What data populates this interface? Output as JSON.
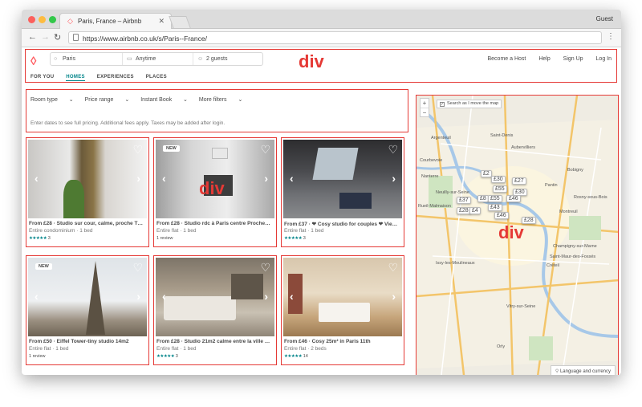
{
  "browser": {
    "tab_title": "Paris, France – Airbnb",
    "guest": "Guest",
    "url": "https://www.airbnb.co.uk/s/Paris--France/"
  },
  "header": {
    "search": {
      "location": "Paris",
      "dates": "Anytime",
      "guests": "2 guests"
    },
    "links": [
      "Become a Host",
      "Help",
      "Sign Up",
      "Log In"
    ],
    "tabs": [
      "FOR YOU",
      "HOMES",
      "EXPERIENCES",
      "PLACES"
    ],
    "active_tab": "HOMES"
  },
  "labels": {
    "header_div": "div",
    "card_div": "div",
    "map_div": "div"
  },
  "filters": {
    "chips": [
      "Room type",
      "Price range",
      "Instant Book",
      "More filters"
    ],
    "note": "Enter dates to see full pricing. Additional fees apply. Taxes may be added after login."
  },
  "listings": [
    {
      "title": "From £28 · Studio sur cour, calme, proche T…",
      "sub": "Entire condominium · 1 bed",
      "stars": "★★★★★",
      "reviews": "3",
      "badge": ""
    },
    {
      "title": "From £28 · Studio rdc à Paris centre Proche…",
      "sub": "Entire flat · 1 bed",
      "stars": "",
      "reviews": "1 review",
      "badge": "NEW"
    },
    {
      "title": "From £37 · ❤ Cosy studio for couples ❤ Vie…",
      "sub": "Entire flat · 1 bed",
      "stars": "★★★★★",
      "reviews": "3",
      "badge": ""
    },
    {
      "title": "From £50 · Eiffel Tower-tiny studio 14m2",
      "sub": "Entire flat · 1 bed",
      "stars": "",
      "reviews": "1 review",
      "badge": "NEW"
    },
    {
      "title": "From £28 · Studio 21m2 calme entre la ville …",
      "sub": "Entire flat · 1 bed",
      "stars": "★★★★★",
      "reviews": "3",
      "badge": ""
    },
    {
      "title": "From £46 · Cosy 25m² in Paris 11th",
      "sub": "Entire flat · 2 beds",
      "stars": "★★★★★",
      "reviews": "14",
      "badge": ""
    }
  ],
  "map": {
    "search_as_move": "Search as I move the map",
    "zoom_in": "+",
    "zoom_out": "−",
    "pins": [
      "£2",
      "£30",
      "£27",
      "£30",
      "£55",
      "£37",
      "£8",
      "£55",
      "£46",
      "£43",
      "£28",
      "£4",
      "£46",
      "£28"
    ],
    "places": [
      "Argenteuil",
      "Saint-Denis",
      "Aubervilliers",
      "Courbevoie",
      "Neuilly-sur-Seine",
      "Pantin",
      "Bobigny",
      "Rosny-sous-Bois",
      "Montreuil",
      "Issy-les-Moulineaux",
      "Vitry-sur-Seine",
      "Créteil",
      "Champigny-sur-Marne",
      "Saint-Maur-des-Fossés",
      "Orly",
      "Rueil-Malmaison",
      "Nanterre"
    ],
    "language": "Language and currency"
  },
  "colors": {
    "brand": "#ff5a5f",
    "teal": "#008489",
    "annotation": "#e53935"
  }
}
